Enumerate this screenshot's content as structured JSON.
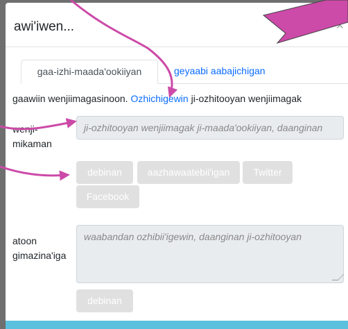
{
  "dialog": {
    "title": "awi'iwen...",
    "close": "×"
  },
  "tabs": [
    {
      "label": "gaa-izhi-maada'ookiiyan"
    },
    {
      "label": "geyaabi aabajichigan"
    }
  ],
  "info": {
    "before": "gaawiin wenjiimagasinoon. ",
    "link": "Ozhichigewin",
    "after": " ji-ozhitooyan wenjiimagak"
  },
  "form": {
    "source_label_line1": "wenji-",
    "source_label_line2": "mikaman",
    "source_placeholder": "ji-ozhitooyan wenjiimagak ji-maada'ookiiyan, daanginan",
    "share_buttons": [
      "debinan",
      "aazhawaatebii'igan",
      "Twitter",
      "Facebook"
    ],
    "message_label_line1": "atoon",
    "message_label_line2": "gimazina'iga",
    "message_placeholder": "waabandan ozhibii'igewin, daanginan ji-ozhitooyan",
    "submit_label": "debinan"
  },
  "colors": {
    "link": "#0a6cff",
    "arrow": "#cc4aa8",
    "button_disabled": "#e0e0e0",
    "footer": "#5bc0de"
  }
}
